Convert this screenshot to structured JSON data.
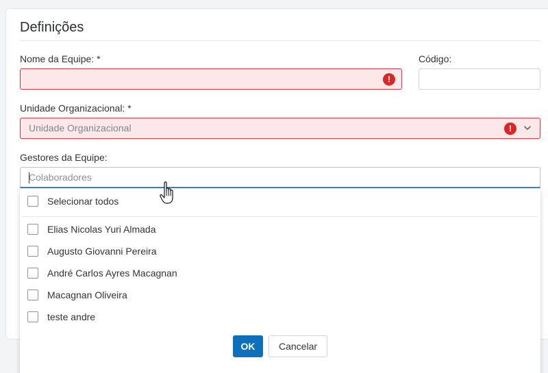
{
  "section": {
    "title": "Definições"
  },
  "form": {
    "team_name_label": "Nome da Equipe: *",
    "team_name_value": "",
    "code_label": "Código:",
    "code_value": "",
    "org_unit_label": "Unidade Organizacional: *",
    "org_unit_placeholder": "Unidade Organizacional",
    "managers_label": "Gestores da Equipe:",
    "managers_placeholder": "Colaboradores",
    "error_glyph": "!"
  },
  "dropdown": {
    "select_all_label": "Selecionar todos",
    "options": [
      {
        "label": "Elias Nicolas Yuri Almada",
        "checked": false
      },
      {
        "label": "Augusto Giovanni Pereira",
        "checked": false
      },
      {
        "label": "André Carlos Ayres Macagnan",
        "checked": false
      },
      {
        "label": "Macagnan Oliveira",
        "checked": false
      },
      {
        "label": "teste andre",
        "checked": false
      }
    ],
    "ok_label": "OK",
    "cancel_label": "Cancelar"
  },
  "colors": {
    "primary": "#0e6fba",
    "error": "#dc2626",
    "error_bg": "#fce8e8",
    "focus": "#3b82c4"
  },
  "icons": [
    "exclamation-circle-icon",
    "chevron-down-icon",
    "hand-pointer-cursor-icon",
    "checkbox-icon"
  ]
}
